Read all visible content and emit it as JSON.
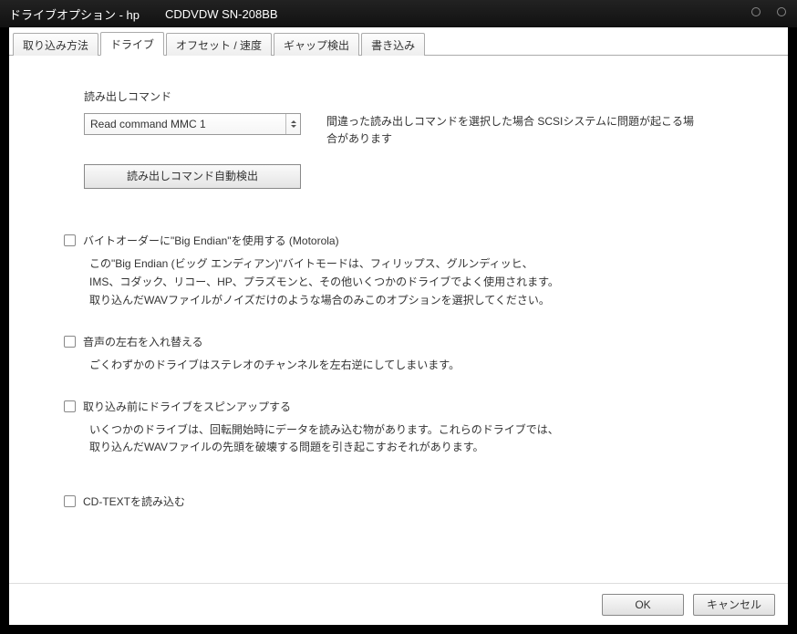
{
  "window": {
    "title_prefix": "ドライブオプション - hp",
    "title_drive": "CDDVDW SN-208BB"
  },
  "tabs": {
    "items": [
      {
        "label": "取り込み方法"
      },
      {
        "label": "ドライブ"
      },
      {
        "label": "オフセット / 速度"
      },
      {
        "label": "ギャップ検出"
      },
      {
        "label": "書き込み"
      }
    ],
    "active_index": 1
  },
  "drive": {
    "read_command_label": "読み出しコマンド",
    "read_command_value": "Read command MMC 1",
    "read_command_hint": "間違った読み出しコマンドを選択した場合 SCSIシステムに問題が起こる場合があります",
    "autodetect_button": "読み出しコマンド自動検出",
    "options": [
      {
        "label": "バイトオーダーに\"Big Endian\"を使用する (Motorola)",
        "description": "この\"Big Endian (ビッグ エンディアン)\"バイトモードは、フィリップス、グルンディッヒ、\nIMS、コダック、リコー、HP、プラズモンと、その他いくつかのドライブでよく使用されます。\n取り込んだWAVファイルがノイズだけのような場合のみこのオプションを選択してください。",
        "checked": false
      },
      {
        "label": "音声の左右を入れ替える",
        "description": "ごくわずかのドライブはステレオのチャンネルを左右逆にしてしまいます。",
        "checked": false
      },
      {
        "label": "取り込み前にドライブをスピンアップする",
        "description": "いくつかのドライブは、回転開始時にデータを読み込む物があります。これらのドライブでは、\n取り込んだWAVファイルの先頭を破壊する問題を引き起こすおそれがあります。",
        "checked": false
      },
      {
        "label": "CD-TEXTを読み込む",
        "description": "",
        "checked": false
      }
    ]
  },
  "footer": {
    "ok": "OK",
    "cancel": "キャンセル"
  }
}
